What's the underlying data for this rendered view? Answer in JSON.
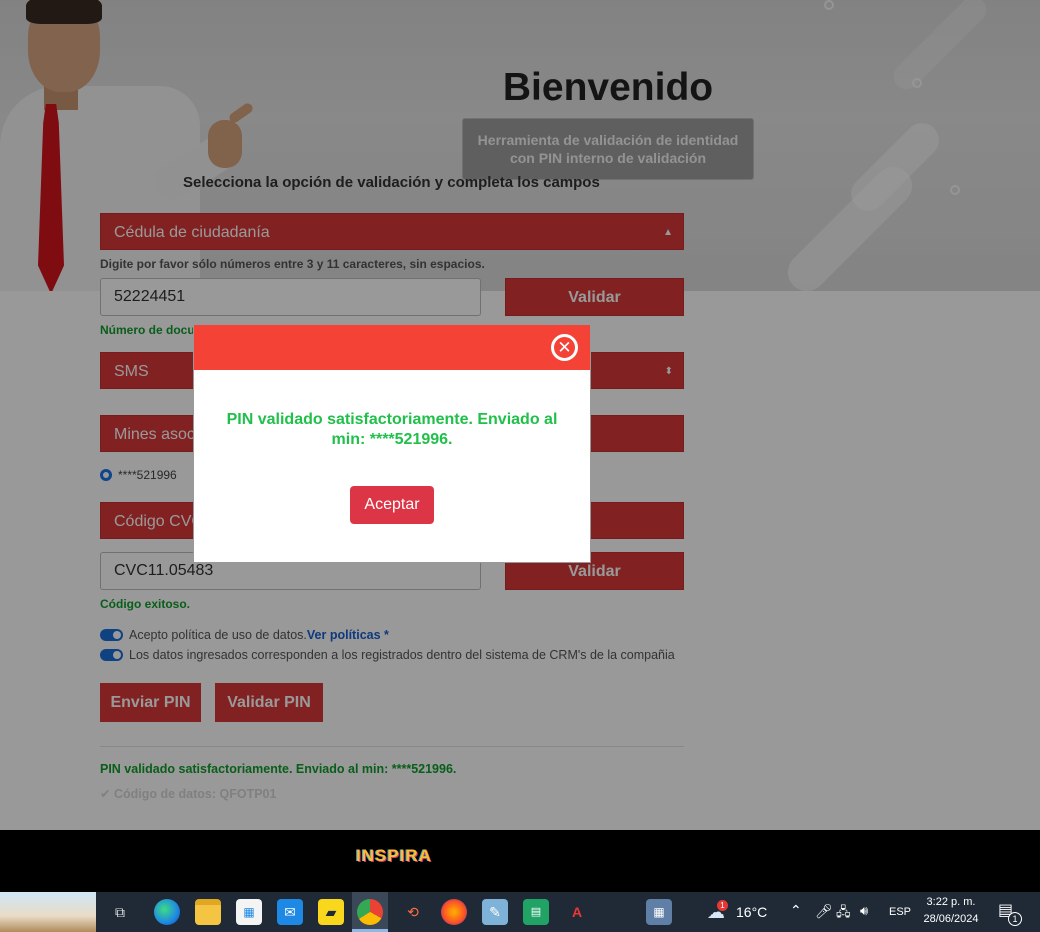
{
  "hero": {
    "title": "Bienvenido",
    "subtitle_line1": "Herramienta de validación de identidad",
    "subtitle_line2": "con PIN interno de validación"
  },
  "form": {
    "section_heading": "Selecciona la opción de validación y completa los campos",
    "doc_type_select": "Cédula de ciudadanía",
    "doc_hint": "Digite por favor sólo números entre 3 y 11 caracteres, sin espacios.",
    "doc_number_value": "52224451",
    "validate_button": "Validar",
    "doc_status_partial": "Número de docu",
    "channel_select": "SMS",
    "mines_select_partial": "Mines asoc",
    "phone_option": "****521996",
    "code_select_partial": "Código CVC",
    "code_value": "CVC11.05483",
    "validate_button_2": "Validar",
    "code_status": "Código exitoso.",
    "policy_text": "Acepto política de uso de datos.",
    "policy_link": "Ver políticas *",
    "crm_text": "Los datos ingresados corresponden a los registrados dentro del sistema de CRM's de la compañia",
    "send_pin_button": "Enviar PIN",
    "validate_pin_button": "Validar PIN",
    "pin_status": "PIN validado satisfactoriamente. Enviado al min: ****521996.",
    "data_code": "✔ Código de datos: QFOTP01"
  },
  "footer": {
    "logo_text": "INSPIRA"
  },
  "modal": {
    "close_glyph": "✕",
    "message_line1": "PIN validado satisfactoriamente. Enviado al",
    "message_line2": "min: ****521996.",
    "accept_button": "Aceptar"
  },
  "taskbar": {
    "weather_badge": "1",
    "temperature": "16°C",
    "language": "ESP",
    "time": "3:22 p. m.",
    "date": "28/06/2024",
    "notification_count": "1",
    "icons": [
      "task-view-icon",
      "edge-icon",
      "file-explorer-icon",
      "microsoft-store-icon",
      "mail-icon",
      "sticky-notes-icon",
      "chrome-icon",
      "remote-app-icon",
      "firefox-icon",
      "notepad-icon",
      "spreadsheet-icon",
      "acrobat-icon",
      "calculator-icon",
      "weather-icon"
    ]
  },
  "colors": {
    "accent_red": "#d93838",
    "modal_header": "#f44336",
    "success_green": "#0f9d2a",
    "link_blue": "#1a5fd0"
  }
}
